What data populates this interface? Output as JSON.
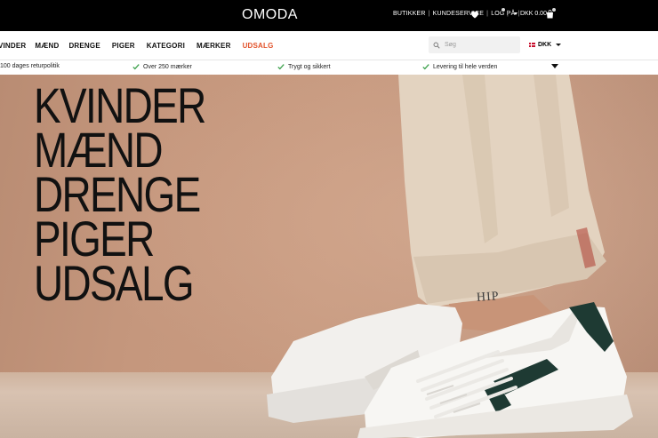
{
  "header": {
    "logo": "OMODA",
    "links": [
      "BUTIKKER",
      "KUNDESERVICE",
      "LOG PÅ"
    ],
    "currency": "DKK 0.00",
    "icons": [
      "heart-icon",
      "shopping-bag-icon",
      "chevron-down-icon"
    ]
  },
  "nav": {
    "items": [
      "KVINDER",
      "MÆND",
      "DRENGE",
      "PIGER",
      "KATEGORI",
      "MÆRKER",
      "UDSALG"
    ],
    "sale_color": "#e2522a",
    "search_placeholder": "Søg",
    "language": "DKK"
  },
  "usp": {
    "items": [
      "100 dages returpolitik",
      "Over 250 mærker",
      "Trygt og sikkert",
      "Levering til hele verden"
    ],
    "check_color": "#3aa04a"
  },
  "hero": {
    "menu": [
      "KVINDER",
      "MÆND",
      "DRENGE",
      "PIGER",
      "UDSALG"
    ],
    "shoe_text": "HIP"
  }
}
